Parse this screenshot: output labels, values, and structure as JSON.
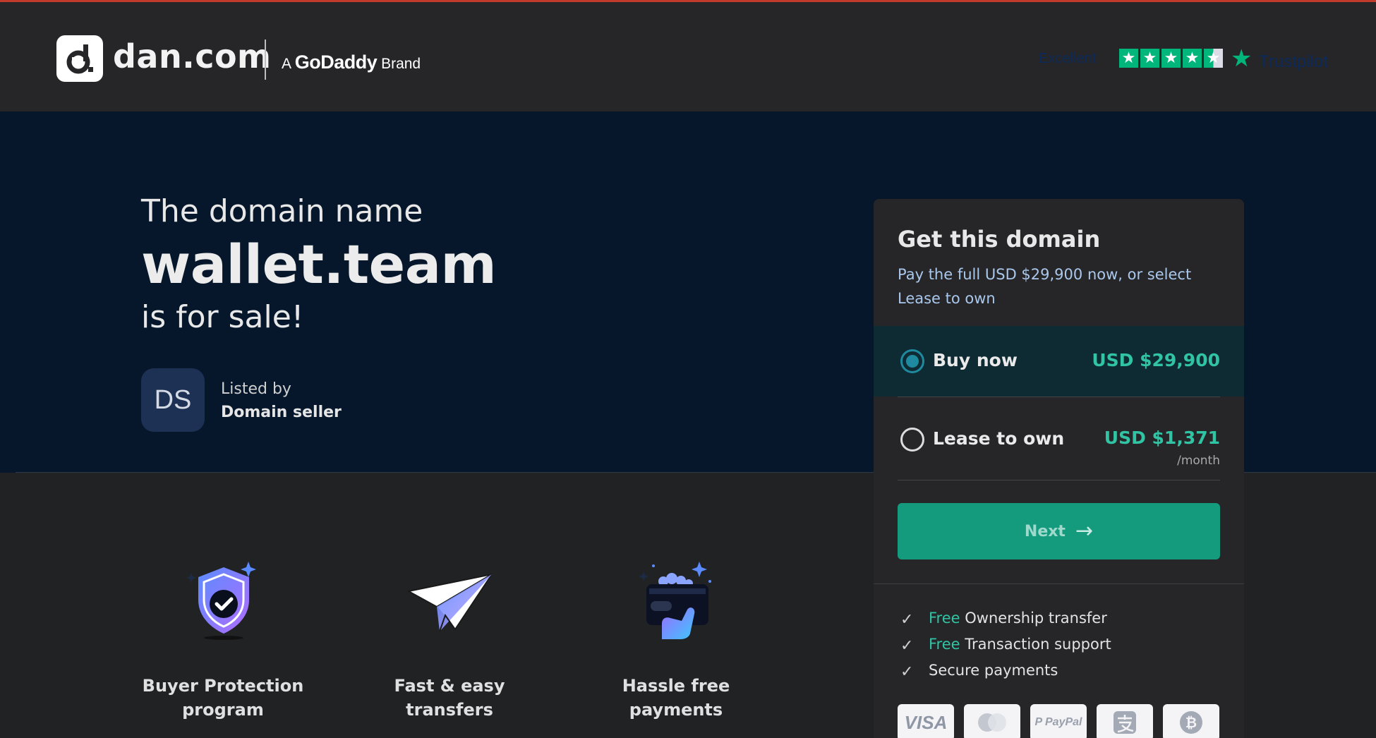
{
  "header": {
    "logo_text": "dan.com",
    "brand_prefix": "A",
    "brand_name": "GoDaddy",
    "brand_suffix": "Brand",
    "trustpilot": {
      "rating_word": "Excellent",
      "stars": 4.5,
      "star_glyph": "★",
      "logo_star": "★",
      "logo_word": "Trustpilot"
    }
  },
  "hero": {
    "intro": "The domain name",
    "domain": "wallet.team",
    "suffix": "is for sale!",
    "seller": {
      "initials": "DS",
      "listed_by": "Listed by",
      "name": "Domain seller"
    }
  },
  "card": {
    "title": "Get this domain",
    "description": "Pay the full USD $29,900 now, or select Lease to own",
    "options": [
      {
        "label": "Buy now",
        "price": "USD $29,900",
        "period": "",
        "selected": true
      },
      {
        "label": "Lease to own",
        "price": "USD $1,371",
        "period": "/month",
        "selected": false
      }
    ],
    "next_label": "Next",
    "next_arrow": "→",
    "perks": [
      {
        "check": "✓",
        "free": "Free",
        "text": "Ownership transfer"
      },
      {
        "check": "✓",
        "free": "Free",
        "text": "Transaction support"
      },
      {
        "check": "✓",
        "free": "",
        "text": "Secure payments"
      }
    ],
    "payment_methods": [
      "VISA",
      "mastercard",
      "PayPal",
      "alipay",
      "bitcoin"
    ]
  },
  "features": [
    {
      "icon": "shield-check-icon",
      "title_line1": "Buyer Protection",
      "title_line2": "program"
    },
    {
      "icon": "paper-plane-icon",
      "title_line1": "Fast & easy",
      "title_line2": "transfers"
    },
    {
      "icon": "hand-card-icon",
      "title_line1": "Hassle free",
      "title_line2": "payments"
    }
  ],
  "colors": {
    "header_bg": "#262628",
    "hero_bg": "#07172b",
    "accent_green": "#30c3a4",
    "button_green": "#149b7d",
    "top_line": "#c0392b",
    "trustpilot_green": "#00b67a"
  }
}
